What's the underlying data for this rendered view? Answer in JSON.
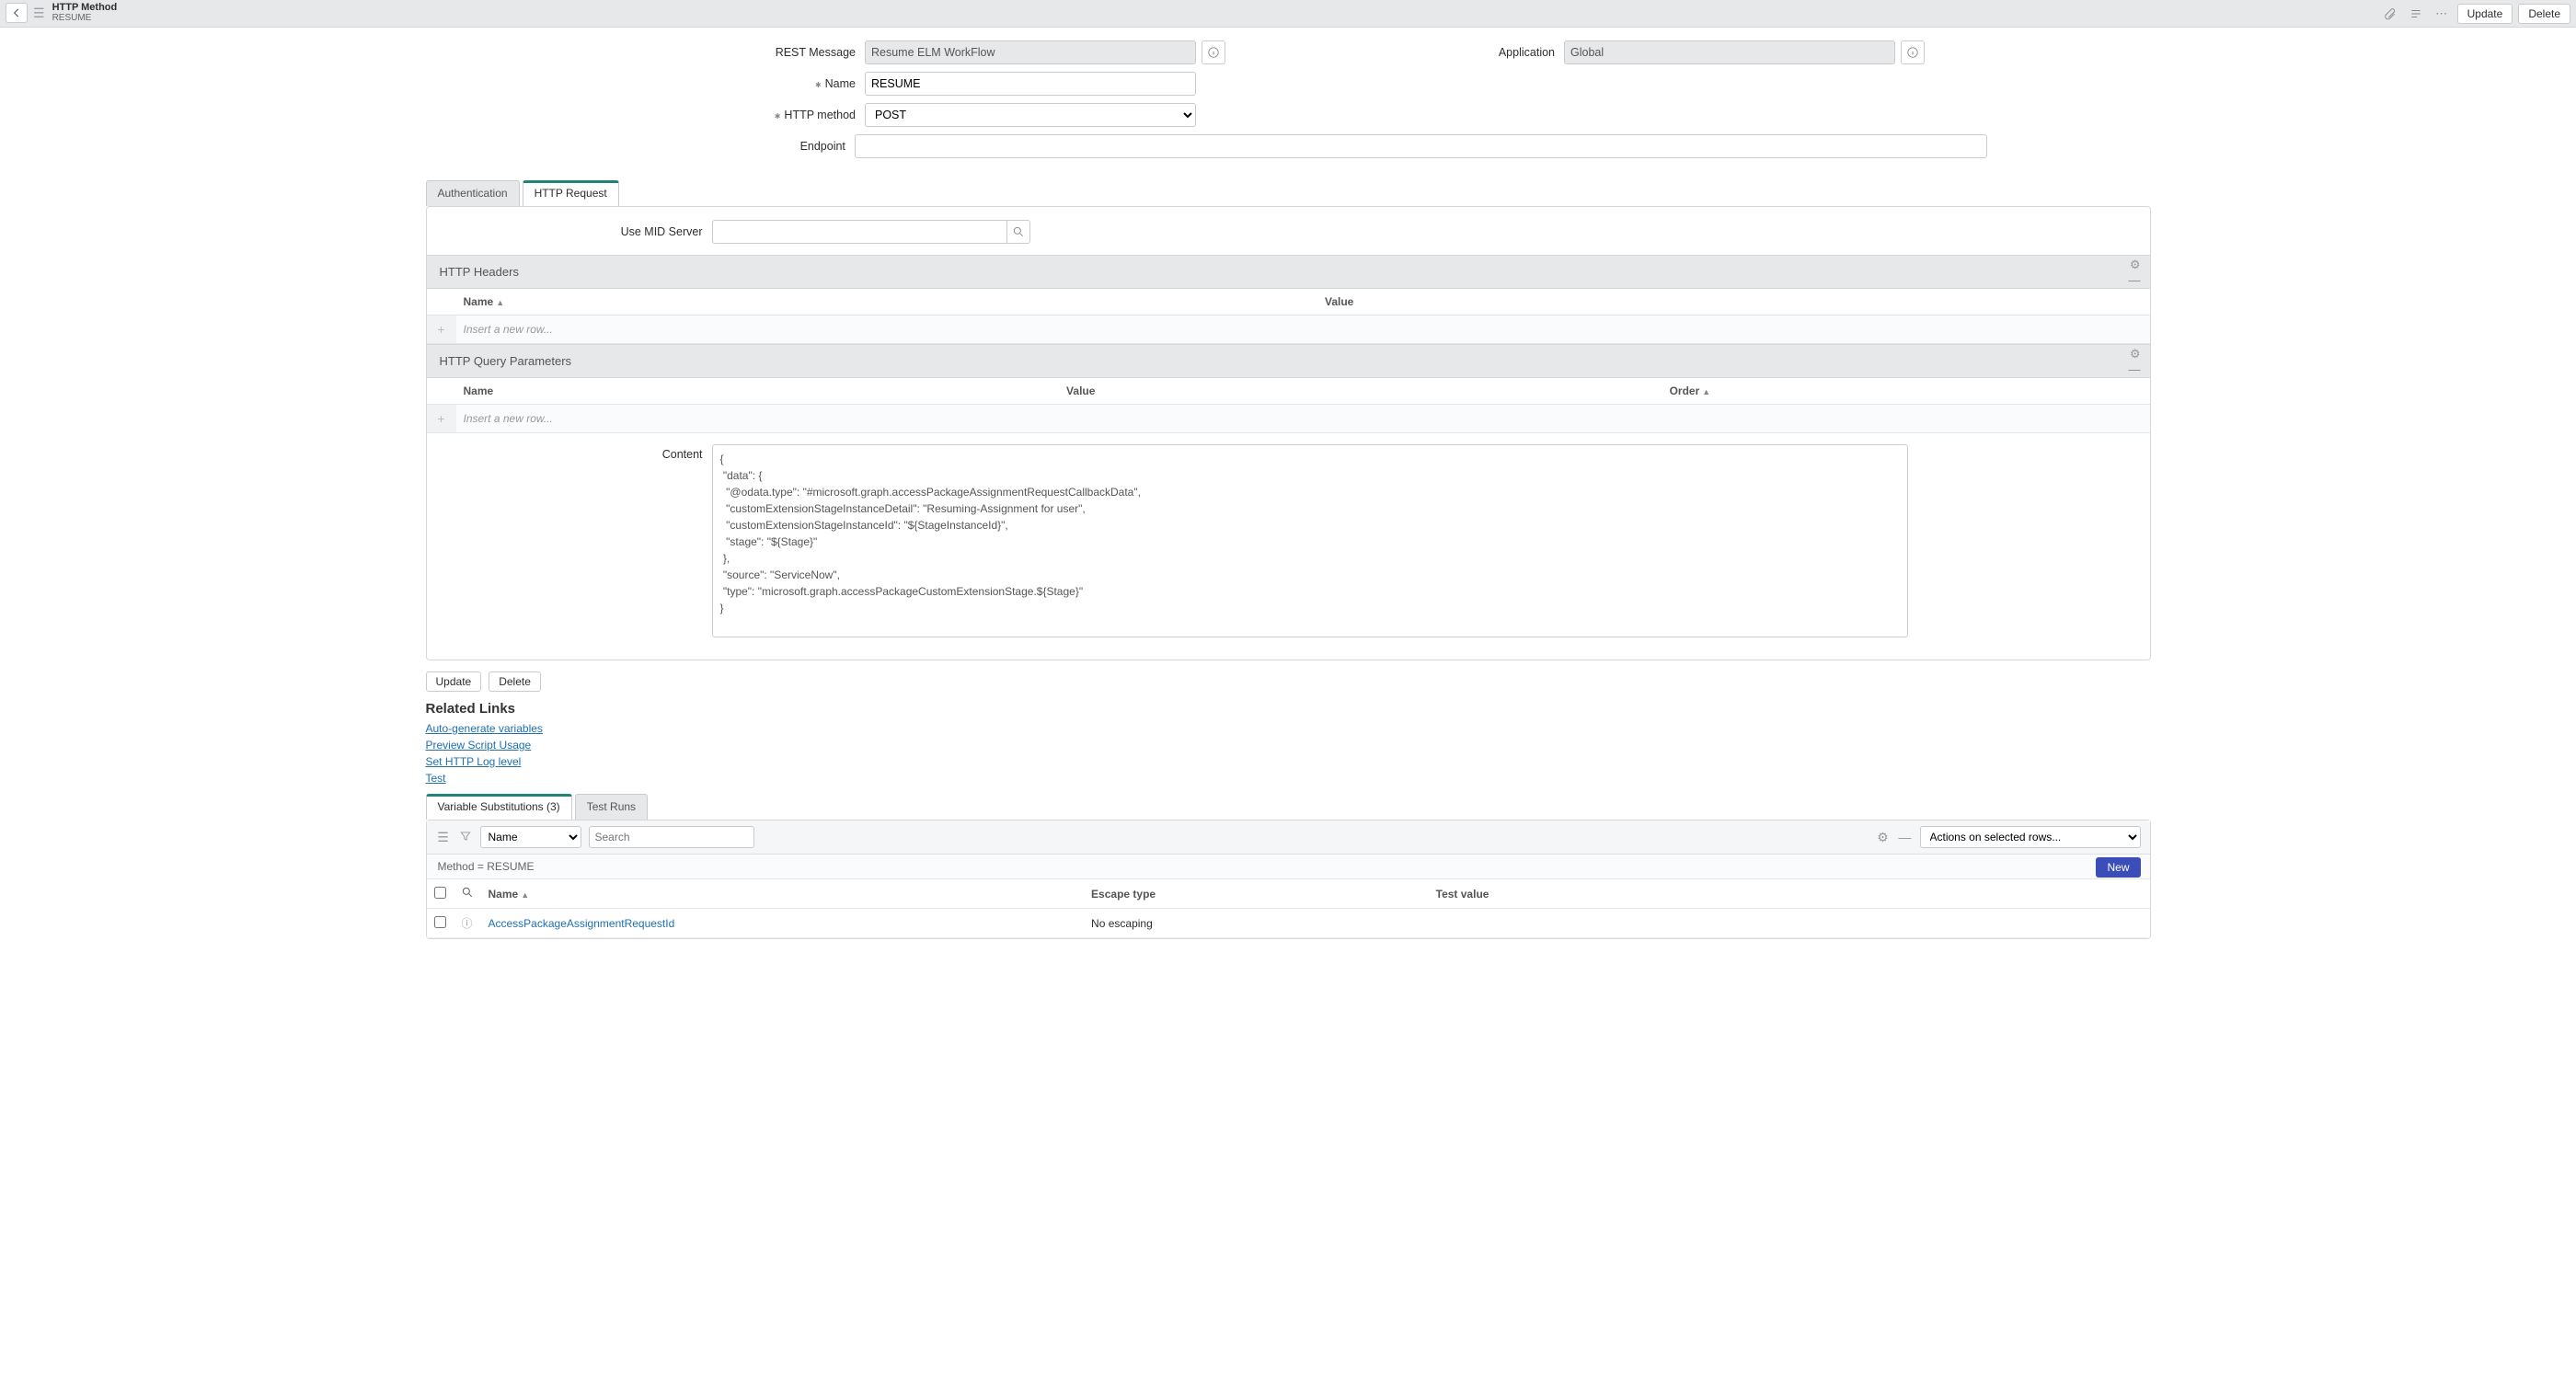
{
  "header": {
    "title": "HTTP Method",
    "subtitle": "RESUME",
    "buttons": {
      "update": "Update",
      "delete": "Delete"
    }
  },
  "form": {
    "labels": {
      "rest_message": "REST Message",
      "name": "Name",
      "http_method": "HTTP method",
      "endpoint": "Endpoint",
      "application": "Application"
    },
    "rest_message": "Resume ELM WorkFlow",
    "name": "RESUME",
    "http_method_selected": "POST",
    "endpoint": "",
    "application": "Global"
  },
  "upper_tabs": {
    "authentication": "Authentication",
    "http_request": "HTTP Request"
  },
  "mid": {
    "label": "Use MID Server",
    "value": ""
  },
  "sections": {
    "headers_title": "HTTP Headers",
    "params_title": "HTTP Query Parameters",
    "cols": {
      "name": "Name",
      "value": "Value",
      "order": "Order"
    },
    "insert_placeholder": "Insert a new row..."
  },
  "content": {
    "label": "Content",
    "value": "{\n \"data\": {\n  \"@odata.type\": \"#microsoft.graph.accessPackageAssignmentRequestCallbackData\",\n  \"customExtensionStageInstanceDetail\": \"Resuming-Assignment for user\",\n  \"customExtensionStageInstanceId\": \"${StageInstanceId}\",\n  \"stage\": \"${Stage}\"\n },\n \"source\": \"ServiceNow\",\n \"type\": \"microsoft.graph.accessPackageCustomExtensionStage.${Stage}\"\n}"
  },
  "bottom_buttons": {
    "update": "Update",
    "delete": "Delete"
  },
  "related": {
    "title": "Related Links",
    "links": [
      "Auto-generate variables",
      "Preview Script Usage",
      "Set HTTP Log level",
      "Test"
    ]
  },
  "lower_tabs": {
    "var_sub": "Variable Substitutions (3)",
    "test_runs": "Test Runs"
  },
  "list_toolbar": {
    "search_field": "Name",
    "search_placeholder": "Search",
    "actions": "Actions on selected rows...",
    "new_btn": "New"
  },
  "list_filter": "Method = RESUME",
  "list_headers": {
    "name": "Name",
    "escape": "Escape type",
    "testval": "Test value"
  },
  "list_rows": [
    {
      "name": "AccessPackageAssignmentRequestId",
      "escape": "No escaping",
      "testval": ""
    }
  ]
}
